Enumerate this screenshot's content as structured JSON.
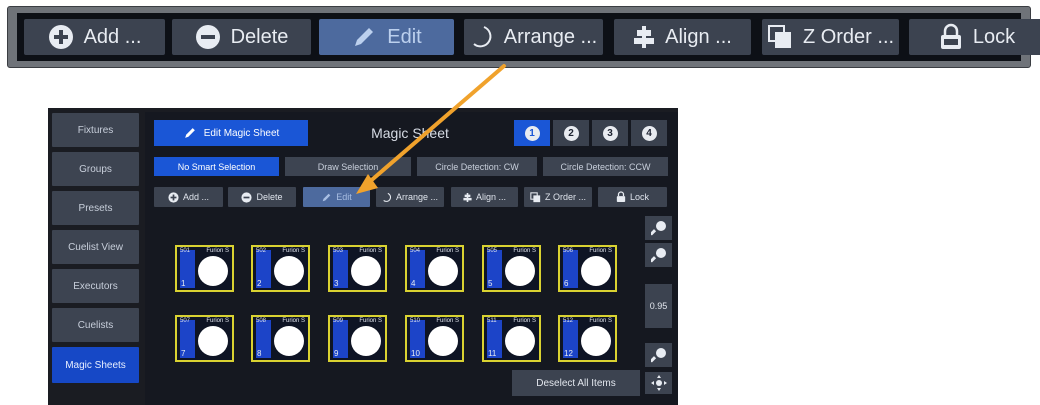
{
  "toolbar": {
    "buttons": [
      {
        "label": "Add ...",
        "icon": "plus-circle-icon"
      },
      {
        "label": "Delete",
        "icon": "minus-circle-icon"
      },
      {
        "label": "Edit",
        "icon": "pencil-icon",
        "active": true
      },
      {
        "label": "Arrange ...",
        "icon": "arc-icon"
      },
      {
        "label": "Align ...",
        "icon": "align-icon"
      },
      {
        "label": "Z Order ...",
        "icon": "z-order-icon"
      },
      {
        "label": "Lock",
        "icon": "lock-icon"
      }
    ]
  },
  "sidebar": {
    "items": [
      {
        "label": "Fixtures"
      },
      {
        "label": "Groups"
      },
      {
        "label": "Presets"
      },
      {
        "label": "Cuelist View"
      },
      {
        "label": "Executors"
      },
      {
        "label": "Cuelists"
      },
      {
        "label": "Magic Sheets",
        "active": true
      }
    ]
  },
  "header": {
    "edit_button": "Edit Magic Sheet",
    "title": "Magic Sheet",
    "pages": [
      "1",
      "2",
      "3",
      "4"
    ]
  },
  "modes": [
    "No Smart Selection",
    "Draw Selection",
    "Circle Detection: CW",
    "Circle Detection: CCW"
  ],
  "small_toolbar": [
    "Add ...",
    "Delete",
    "Edit",
    "Arrange ...",
    "Align ...",
    "Z Order ...",
    "Lock"
  ],
  "fixtures": [
    {
      "id": "501",
      "name": "Furion S",
      "num": "1"
    },
    {
      "id": "502",
      "name": "Furion S",
      "num": "2"
    },
    {
      "id": "503",
      "name": "Furion S",
      "num": "3"
    },
    {
      "id": "504",
      "name": "Furion S",
      "num": "4"
    },
    {
      "id": "505",
      "name": "Furion S",
      "num": "5"
    },
    {
      "id": "506",
      "name": "Furion S",
      "num": "6"
    },
    {
      "id": "507",
      "name": "Furion S",
      "num": "7"
    },
    {
      "id": "508",
      "name": "Furion S",
      "num": "8"
    },
    {
      "id": "509",
      "name": "Furion S",
      "num": "9"
    },
    {
      "id": "510",
      "name": "Furion S",
      "num": "10"
    },
    {
      "id": "511",
      "name": "Furion S",
      "num": "11"
    },
    {
      "id": "512",
      "name": "Furion S",
      "num": "12"
    }
  ],
  "zoom": {
    "value": "0.95"
  },
  "deselect_label": "Deselect All Items",
  "colors": {
    "accent": "#1a56d6",
    "highlight_arrow": "#f0a22c",
    "fixture_border": "#d9d231"
  }
}
